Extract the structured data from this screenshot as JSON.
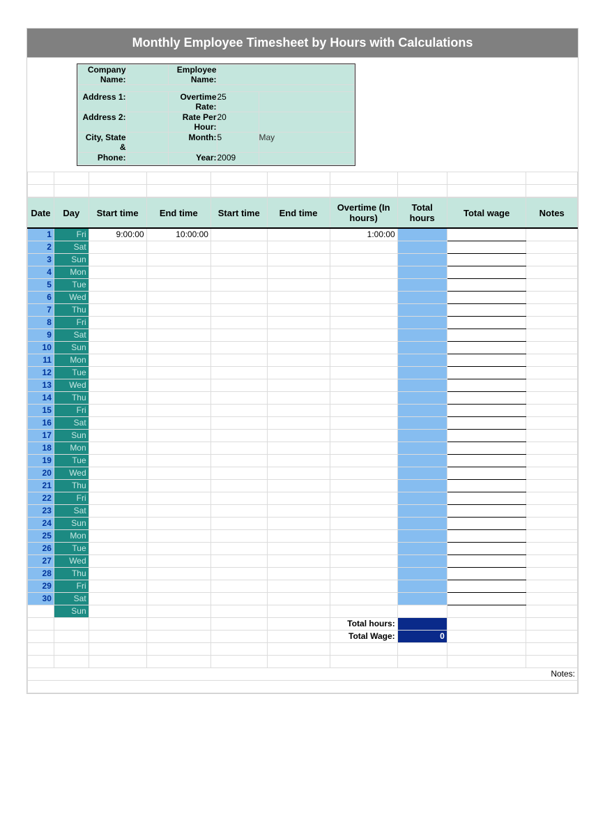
{
  "title": "Monthly Employee Timesheet by Hours with Calculations",
  "info": {
    "companyName": {
      "label": "Company Name:",
      "value": ""
    },
    "employeeName": {
      "label": "Employee Name:",
      "value": ""
    },
    "address1": {
      "label": "Address 1:",
      "value": ""
    },
    "overtimeRate": {
      "label": "Overtime Rate:",
      "value": "25"
    },
    "address2": {
      "label": "Address 2:",
      "value": ""
    },
    "ratePerHour": {
      "label": "Rate Per Hour:",
      "value": "20"
    },
    "cityStateZip": {
      "label": "City, State &",
      "value": ""
    },
    "month": {
      "label": "Month:",
      "value": "5",
      "name": "May"
    },
    "phone": {
      "label": "Phone:",
      "value": ""
    },
    "year": {
      "label": "Year:",
      "value": "2009"
    }
  },
  "columns": {
    "date": "Date",
    "day": "Day",
    "start1": "Start time",
    "end1": "End time",
    "start2": "Start time",
    "end2": "End time",
    "overtime": "Overtime (In hours)",
    "totalHours": "Total hours",
    "totalWage": "Total wage",
    "notes": "Notes"
  },
  "rows": [
    {
      "date": "1",
      "day": "Fri",
      "start1": "9:00:00",
      "end1": "10:00:00",
      "start2": "",
      "end2": "",
      "overtime": "1:00:00",
      "totalHours": "",
      "totalWage": "",
      "notes": ""
    },
    {
      "date": "2",
      "day": "Sat"
    },
    {
      "date": "3",
      "day": "Sun"
    },
    {
      "date": "4",
      "day": "Mon"
    },
    {
      "date": "5",
      "day": "Tue"
    },
    {
      "date": "6",
      "day": "Wed"
    },
    {
      "date": "7",
      "day": "Thu"
    },
    {
      "date": "8",
      "day": "Fri"
    },
    {
      "date": "9",
      "day": "Sat"
    },
    {
      "date": "10",
      "day": "Sun"
    },
    {
      "date": "11",
      "day": "Mon"
    },
    {
      "date": "12",
      "day": "Tue"
    },
    {
      "date": "13",
      "day": "Wed"
    },
    {
      "date": "14",
      "day": "Thu"
    },
    {
      "date": "15",
      "day": "Fri"
    },
    {
      "date": "16",
      "day": "Sat"
    },
    {
      "date": "17",
      "day": "Sun"
    },
    {
      "date": "18",
      "day": "Mon"
    },
    {
      "date": "19",
      "day": "Tue"
    },
    {
      "date": "20",
      "day": "Wed"
    },
    {
      "date": "21",
      "day": "Thu"
    },
    {
      "date": "22",
      "day": "Fri"
    },
    {
      "date": "23",
      "day": "Sat"
    },
    {
      "date": "24",
      "day": "Sun"
    },
    {
      "date": "25",
      "day": "Mon"
    },
    {
      "date": "26",
      "day": "Tue"
    },
    {
      "date": "27",
      "day": "Wed"
    },
    {
      "date": "28",
      "day": "Thu"
    },
    {
      "date": "29",
      "day": "Fri"
    },
    {
      "date": "30",
      "day": "Sat"
    }
  ],
  "extraDay": "Sun",
  "totals": {
    "hoursLabel": "Total hours:",
    "hoursValue": "",
    "wageLabel": "Total Wage:",
    "wageValue": "0"
  },
  "notesLabel": "Notes:"
}
